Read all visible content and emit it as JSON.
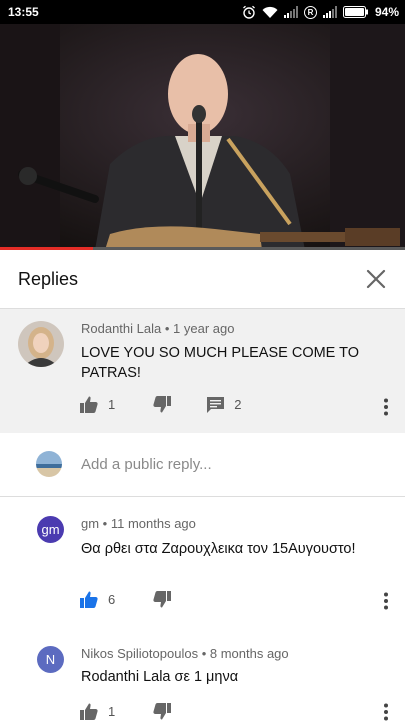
{
  "status": {
    "time": "13:55",
    "battery": "94%",
    "sim_badge": "R"
  },
  "video": {
    "progress": 0.23
  },
  "header": {
    "title": "Replies"
  },
  "comments": [
    {
      "author": "Rodanthi Lala",
      "age": "1 year ago",
      "text": "LOVE YOU SO MUCH PLEASE COME TO PATRAS!",
      "likes": "1",
      "replies": "2"
    },
    {
      "author": "gm",
      "age": "11 months ago",
      "text": "Θα ρθει στα Ζαρουχλεικα τον 15Αυγουστο!",
      "likes": "6",
      "avatar_letters": "gm",
      "avatar_color": "#4b3bb0"
    },
    {
      "author": "Nikos Spiliotopoulos",
      "age": "8 months ago",
      "text": "Rodanthi Lala σε 1 μηνα",
      "likes": "1",
      "avatar_letters": "N",
      "avatar_color": "#5c6bc0"
    }
  ],
  "reply_box": {
    "placeholder": "Add a public reply..."
  },
  "colors": {
    "accent_blue": "#1a73e8",
    "progress_red": "#e52d27"
  }
}
